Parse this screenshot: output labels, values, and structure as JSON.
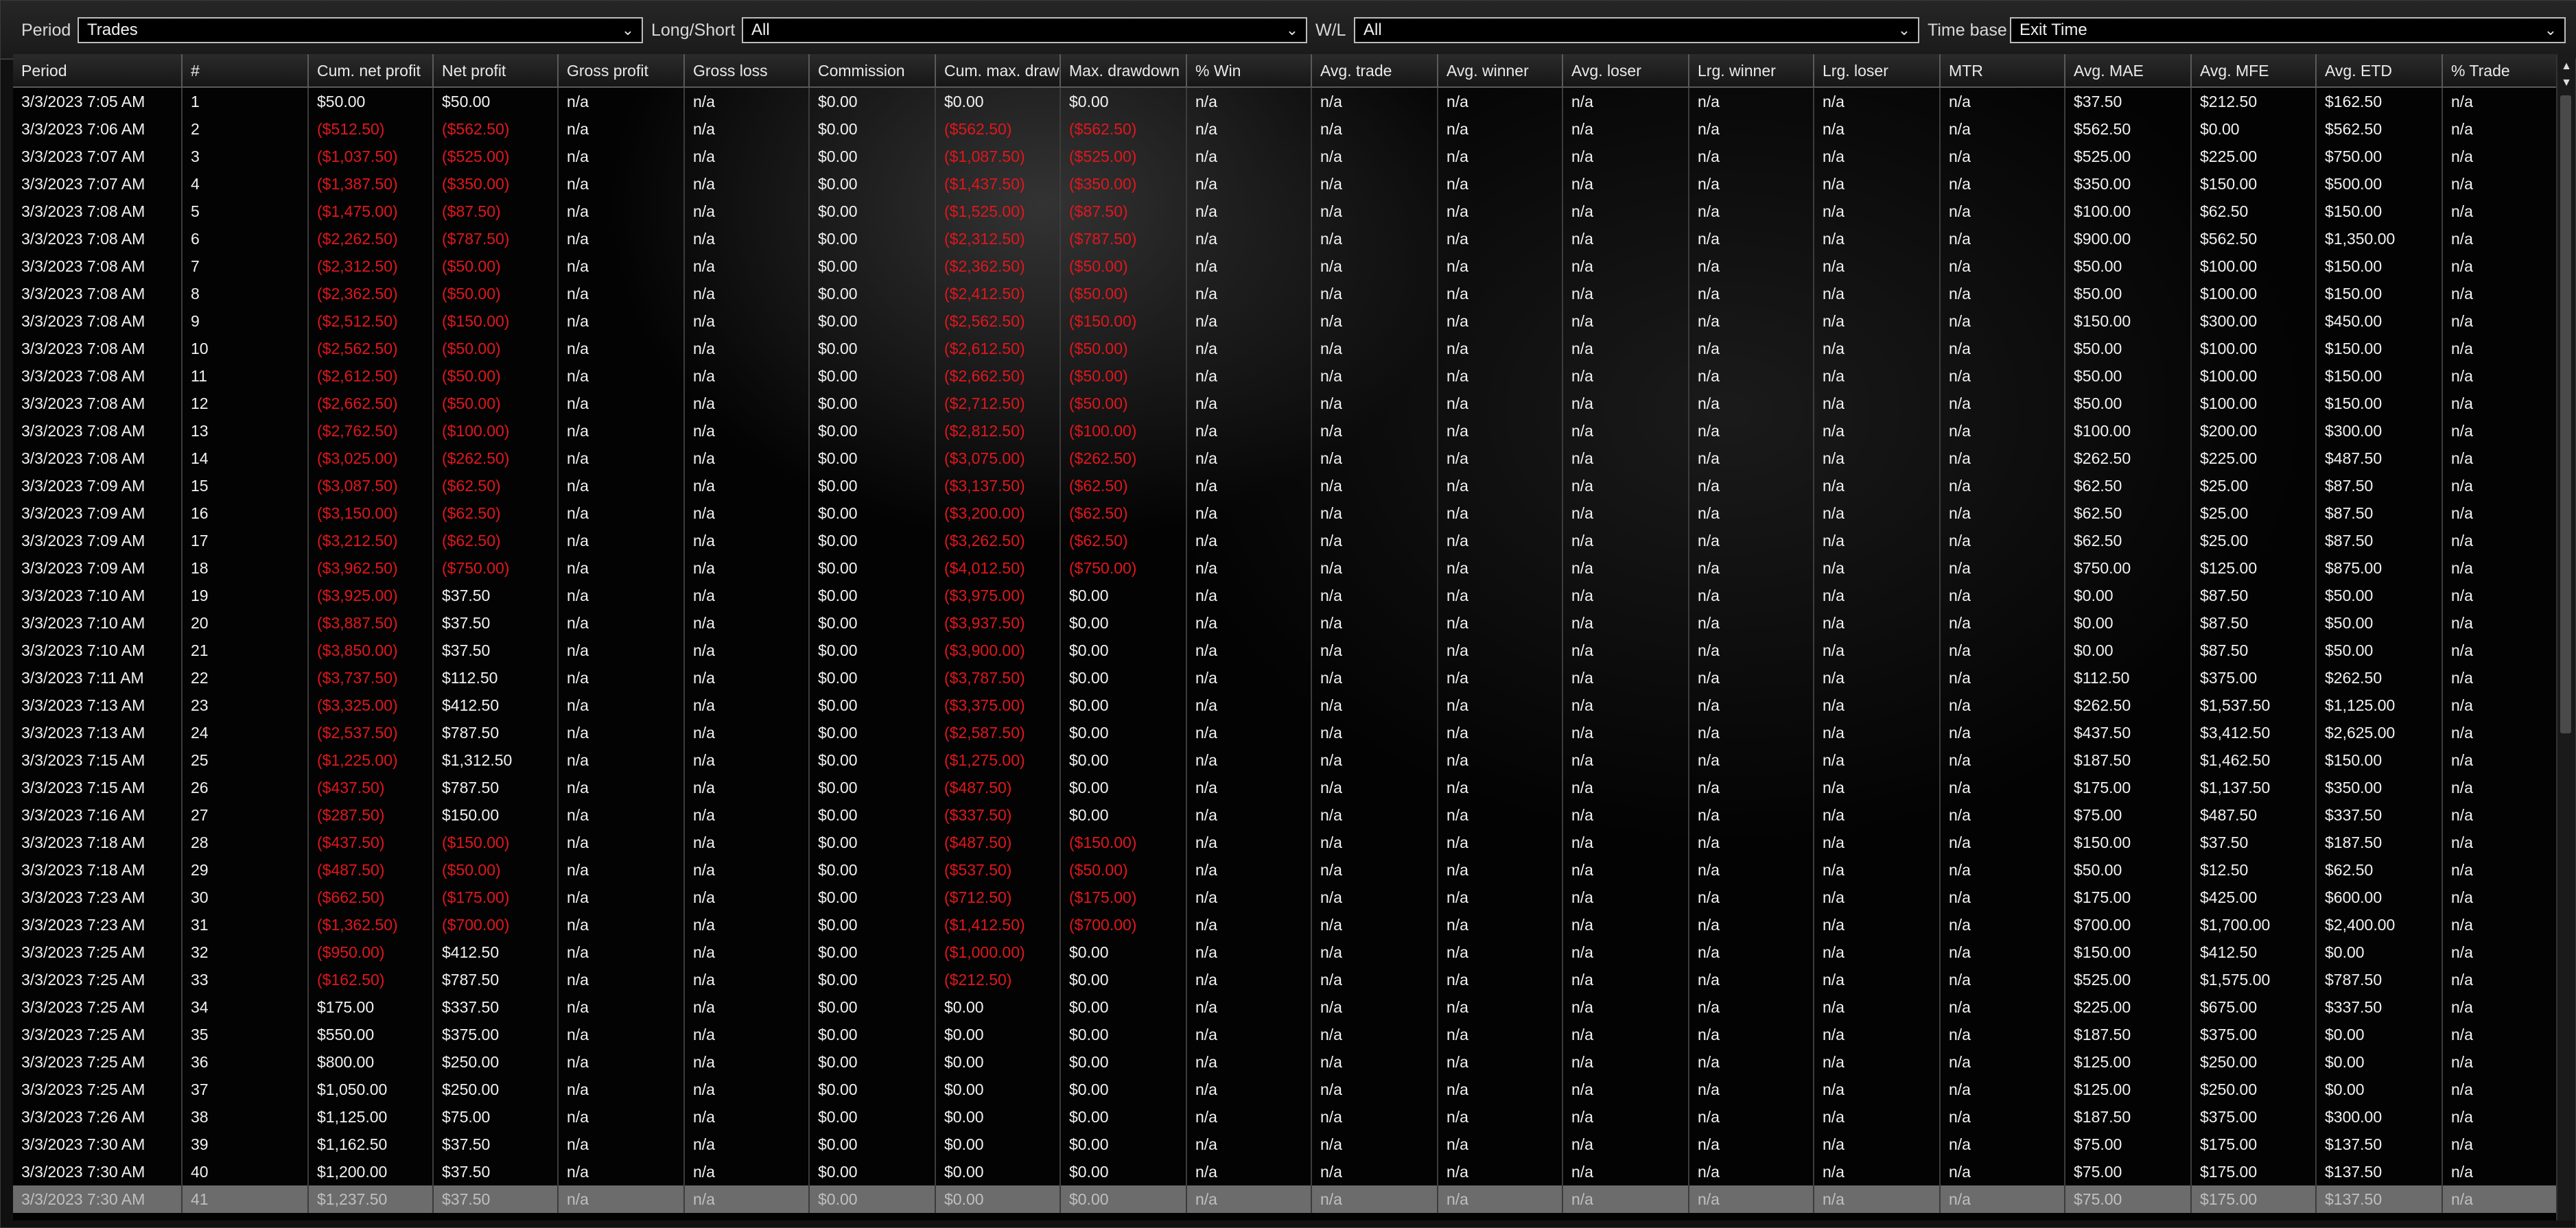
{
  "filters": {
    "period": {
      "label": "Period",
      "value": "Trades"
    },
    "long_short": {
      "label": "Long/Short",
      "value": "All"
    },
    "wl": {
      "label": "W/L",
      "value": "All"
    },
    "time_base": {
      "label": "Time base",
      "value": "Exit Time"
    }
  },
  "table": {
    "columns": [
      "Period",
      "#",
      "Cum. net profit",
      "Net profit",
      "Gross profit",
      "Gross loss",
      "Commission",
      "Cum. max. drawdown",
      "Max. drawdown",
      "% Win",
      "Avg. trade",
      "Avg. winner",
      "Avg. loser",
      "Lrg. winner",
      "Lrg. loser",
      "MTR",
      "Avg. MAE",
      "Avg. MFE",
      "Avg. ETD",
      "% Trade"
    ],
    "rows": [
      [
        "3/3/2023 7:05 AM",
        "1",
        "$50.00",
        "$50.00",
        "n/a",
        "n/a",
        "$0.00",
        "$0.00",
        "$0.00",
        "n/a",
        "n/a",
        "n/a",
        "n/a",
        "n/a",
        "n/a",
        "n/a",
        "$37.50",
        "$212.50",
        "$162.50",
        "n/a"
      ],
      [
        "3/3/2023 7:06 AM",
        "2",
        "($512.50)",
        "($562.50)",
        "n/a",
        "n/a",
        "$0.00",
        "($562.50)",
        "($562.50)",
        "n/a",
        "n/a",
        "n/a",
        "n/a",
        "n/a",
        "n/a",
        "n/a",
        "$562.50",
        "$0.00",
        "$562.50",
        "n/a"
      ],
      [
        "3/3/2023 7:07 AM",
        "3",
        "($1,037.50)",
        "($525.00)",
        "n/a",
        "n/a",
        "$0.00",
        "($1,087.50)",
        "($525.00)",
        "n/a",
        "n/a",
        "n/a",
        "n/a",
        "n/a",
        "n/a",
        "n/a",
        "$525.00",
        "$225.00",
        "$750.00",
        "n/a"
      ],
      [
        "3/3/2023 7:07 AM",
        "4",
        "($1,387.50)",
        "($350.00)",
        "n/a",
        "n/a",
        "$0.00",
        "($1,437.50)",
        "($350.00)",
        "n/a",
        "n/a",
        "n/a",
        "n/a",
        "n/a",
        "n/a",
        "n/a",
        "$350.00",
        "$150.00",
        "$500.00",
        "n/a"
      ],
      [
        "3/3/2023 7:08 AM",
        "5",
        "($1,475.00)",
        "($87.50)",
        "n/a",
        "n/a",
        "$0.00",
        "($1,525.00)",
        "($87.50)",
        "n/a",
        "n/a",
        "n/a",
        "n/a",
        "n/a",
        "n/a",
        "n/a",
        "$100.00",
        "$62.50",
        "$150.00",
        "n/a"
      ],
      [
        "3/3/2023 7:08 AM",
        "6",
        "($2,262.50)",
        "($787.50)",
        "n/a",
        "n/a",
        "$0.00",
        "($2,312.50)",
        "($787.50)",
        "n/a",
        "n/a",
        "n/a",
        "n/a",
        "n/a",
        "n/a",
        "n/a",
        "$900.00",
        "$562.50",
        "$1,350.00",
        "n/a"
      ],
      [
        "3/3/2023 7:08 AM",
        "7",
        "($2,312.50)",
        "($50.00)",
        "n/a",
        "n/a",
        "$0.00",
        "($2,362.50)",
        "($50.00)",
        "n/a",
        "n/a",
        "n/a",
        "n/a",
        "n/a",
        "n/a",
        "n/a",
        "$50.00",
        "$100.00",
        "$150.00",
        "n/a"
      ],
      [
        "3/3/2023 7:08 AM",
        "8",
        "($2,362.50)",
        "($50.00)",
        "n/a",
        "n/a",
        "$0.00",
        "($2,412.50)",
        "($50.00)",
        "n/a",
        "n/a",
        "n/a",
        "n/a",
        "n/a",
        "n/a",
        "n/a",
        "$50.00",
        "$100.00",
        "$150.00",
        "n/a"
      ],
      [
        "3/3/2023 7:08 AM",
        "9",
        "($2,512.50)",
        "($150.00)",
        "n/a",
        "n/a",
        "$0.00",
        "($2,562.50)",
        "($150.00)",
        "n/a",
        "n/a",
        "n/a",
        "n/a",
        "n/a",
        "n/a",
        "n/a",
        "$150.00",
        "$300.00",
        "$450.00",
        "n/a"
      ],
      [
        "3/3/2023 7:08 AM",
        "10",
        "($2,562.50)",
        "($50.00)",
        "n/a",
        "n/a",
        "$0.00",
        "($2,612.50)",
        "($50.00)",
        "n/a",
        "n/a",
        "n/a",
        "n/a",
        "n/a",
        "n/a",
        "n/a",
        "$50.00",
        "$100.00",
        "$150.00",
        "n/a"
      ],
      [
        "3/3/2023 7:08 AM",
        "11",
        "($2,612.50)",
        "($50.00)",
        "n/a",
        "n/a",
        "$0.00",
        "($2,662.50)",
        "($50.00)",
        "n/a",
        "n/a",
        "n/a",
        "n/a",
        "n/a",
        "n/a",
        "n/a",
        "$50.00",
        "$100.00",
        "$150.00",
        "n/a"
      ],
      [
        "3/3/2023 7:08 AM",
        "12",
        "($2,662.50)",
        "($50.00)",
        "n/a",
        "n/a",
        "$0.00",
        "($2,712.50)",
        "($50.00)",
        "n/a",
        "n/a",
        "n/a",
        "n/a",
        "n/a",
        "n/a",
        "n/a",
        "$50.00",
        "$100.00",
        "$150.00",
        "n/a"
      ],
      [
        "3/3/2023 7:08 AM",
        "13",
        "($2,762.50)",
        "($100.00)",
        "n/a",
        "n/a",
        "$0.00",
        "($2,812.50)",
        "($100.00)",
        "n/a",
        "n/a",
        "n/a",
        "n/a",
        "n/a",
        "n/a",
        "n/a",
        "$100.00",
        "$200.00",
        "$300.00",
        "n/a"
      ],
      [
        "3/3/2023 7:08 AM",
        "14",
        "($3,025.00)",
        "($262.50)",
        "n/a",
        "n/a",
        "$0.00",
        "($3,075.00)",
        "($262.50)",
        "n/a",
        "n/a",
        "n/a",
        "n/a",
        "n/a",
        "n/a",
        "n/a",
        "$262.50",
        "$225.00",
        "$487.50",
        "n/a"
      ],
      [
        "3/3/2023 7:09 AM",
        "15",
        "($3,087.50)",
        "($62.50)",
        "n/a",
        "n/a",
        "$0.00",
        "($3,137.50)",
        "($62.50)",
        "n/a",
        "n/a",
        "n/a",
        "n/a",
        "n/a",
        "n/a",
        "n/a",
        "$62.50",
        "$25.00",
        "$87.50",
        "n/a"
      ],
      [
        "3/3/2023 7:09 AM",
        "16",
        "($3,150.00)",
        "($62.50)",
        "n/a",
        "n/a",
        "$0.00",
        "($3,200.00)",
        "($62.50)",
        "n/a",
        "n/a",
        "n/a",
        "n/a",
        "n/a",
        "n/a",
        "n/a",
        "$62.50",
        "$25.00",
        "$87.50",
        "n/a"
      ],
      [
        "3/3/2023 7:09 AM",
        "17",
        "($3,212.50)",
        "($62.50)",
        "n/a",
        "n/a",
        "$0.00",
        "($3,262.50)",
        "($62.50)",
        "n/a",
        "n/a",
        "n/a",
        "n/a",
        "n/a",
        "n/a",
        "n/a",
        "$62.50",
        "$25.00",
        "$87.50",
        "n/a"
      ],
      [
        "3/3/2023 7:09 AM",
        "18",
        "($3,962.50)",
        "($750.00)",
        "n/a",
        "n/a",
        "$0.00",
        "($4,012.50)",
        "($750.00)",
        "n/a",
        "n/a",
        "n/a",
        "n/a",
        "n/a",
        "n/a",
        "n/a",
        "$750.00",
        "$125.00",
        "$875.00",
        "n/a"
      ],
      [
        "3/3/2023 7:10 AM",
        "19",
        "($3,925.00)",
        "$37.50",
        "n/a",
        "n/a",
        "$0.00",
        "($3,975.00)",
        "$0.00",
        "n/a",
        "n/a",
        "n/a",
        "n/a",
        "n/a",
        "n/a",
        "n/a",
        "$0.00",
        "$87.50",
        "$50.00",
        "n/a"
      ],
      [
        "3/3/2023 7:10 AM",
        "20",
        "($3,887.50)",
        "$37.50",
        "n/a",
        "n/a",
        "$0.00",
        "($3,937.50)",
        "$0.00",
        "n/a",
        "n/a",
        "n/a",
        "n/a",
        "n/a",
        "n/a",
        "n/a",
        "$0.00",
        "$87.50",
        "$50.00",
        "n/a"
      ],
      [
        "3/3/2023 7:10 AM",
        "21",
        "($3,850.00)",
        "$37.50",
        "n/a",
        "n/a",
        "$0.00",
        "($3,900.00)",
        "$0.00",
        "n/a",
        "n/a",
        "n/a",
        "n/a",
        "n/a",
        "n/a",
        "n/a",
        "$0.00",
        "$87.50",
        "$50.00",
        "n/a"
      ],
      [
        "3/3/2023 7:11 AM",
        "22",
        "($3,737.50)",
        "$112.50",
        "n/a",
        "n/a",
        "$0.00",
        "($3,787.50)",
        "$0.00",
        "n/a",
        "n/a",
        "n/a",
        "n/a",
        "n/a",
        "n/a",
        "n/a",
        "$112.50",
        "$375.00",
        "$262.50",
        "n/a"
      ],
      [
        "3/3/2023 7:13 AM",
        "23",
        "($3,325.00)",
        "$412.50",
        "n/a",
        "n/a",
        "$0.00",
        "($3,375.00)",
        "$0.00",
        "n/a",
        "n/a",
        "n/a",
        "n/a",
        "n/a",
        "n/a",
        "n/a",
        "$262.50",
        "$1,537.50",
        "$1,125.00",
        "n/a"
      ],
      [
        "3/3/2023 7:13 AM",
        "24",
        "($2,537.50)",
        "$787.50",
        "n/a",
        "n/a",
        "$0.00",
        "($2,587.50)",
        "$0.00",
        "n/a",
        "n/a",
        "n/a",
        "n/a",
        "n/a",
        "n/a",
        "n/a",
        "$437.50",
        "$3,412.50",
        "$2,625.00",
        "n/a"
      ],
      [
        "3/3/2023 7:15 AM",
        "25",
        "($1,225.00)",
        "$1,312.50",
        "n/a",
        "n/a",
        "$0.00",
        "($1,275.00)",
        "$0.00",
        "n/a",
        "n/a",
        "n/a",
        "n/a",
        "n/a",
        "n/a",
        "n/a",
        "$187.50",
        "$1,462.50",
        "$150.00",
        "n/a"
      ],
      [
        "3/3/2023 7:15 AM",
        "26",
        "($437.50)",
        "$787.50",
        "n/a",
        "n/a",
        "$0.00",
        "($487.50)",
        "$0.00",
        "n/a",
        "n/a",
        "n/a",
        "n/a",
        "n/a",
        "n/a",
        "n/a",
        "$175.00",
        "$1,137.50",
        "$350.00",
        "n/a"
      ],
      [
        "3/3/2023 7:16 AM",
        "27",
        "($287.50)",
        "$150.00",
        "n/a",
        "n/a",
        "$0.00",
        "($337.50)",
        "$0.00",
        "n/a",
        "n/a",
        "n/a",
        "n/a",
        "n/a",
        "n/a",
        "n/a",
        "$75.00",
        "$487.50",
        "$337.50",
        "n/a"
      ],
      [
        "3/3/2023 7:18 AM",
        "28",
        "($437.50)",
        "($150.00)",
        "n/a",
        "n/a",
        "$0.00",
        "($487.50)",
        "($150.00)",
        "n/a",
        "n/a",
        "n/a",
        "n/a",
        "n/a",
        "n/a",
        "n/a",
        "$150.00",
        "$37.50",
        "$187.50",
        "n/a"
      ],
      [
        "3/3/2023 7:18 AM",
        "29",
        "($487.50)",
        "($50.00)",
        "n/a",
        "n/a",
        "$0.00",
        "($537.50)",
        "($50.00)",
        "n/a",
        "n/a",
        "n/a",
        "n/a",
        "n/a",
        "n/a",
        "n/a",
        "$50.00",
        "$12.50",
        "$62.50",
        "n/a"
      ],
      [
        "3/3/2023 7:23 AM",
        "30",
        "($662.50)",
        "($175.00)",
        "n/a",
        "n/a",
        "$0.00",
        "($712.50)",
        "($175.00)",
        "n/a",
        "n/a",
        "n/a",
        "n/a",
        "n/a",
        "n/a",
        "n/a",
        "$175.00",
        "$425.00",
        "$600.00",
        "n/a"
      ],
      [
        "3/3/2023 7:23 AM",
        "31",
        "($1,362.50)",
        "($700.00)",
        "n/a",
        "n/a",
        "$0.00",
        "($1,412.50)",
        "($700.00)",
        "n/a",
        "n/a",
        "n/a",
        "n/a",
        "n/a",
        "n/a",
        "n/a",
        "$700.00",
        "$1,700.00",
        "$2,400.00",
        "n/a"
      ],
      [
        "3/3/2023 7:25 AM",
        "32",
        "($950.00)",
        "$412.50",
        "n/a",
        "n/a",
        "$0.00",
        "($1,000.00)",
        "$0.00",
        "n/a",
        "n/a",
        "n/a",
        "n/a",
        "n/a",
        "n/a",
        "n/a",
        "$150.00",
        "$412.50",
        "$0.00",
        "n/a"
      ],
      [
        "3/3/2023 7:25 AM",
        "33",
        "($162.50)",
        "$787.50",
        "n/a",
        "n/a",
        "$0.00",
        "($212.50)",
        "$0.00",
        "n/a",
        "n/a",
        "n/a",
        "n/a",
        "n/a",
        "n/a",
        "n/a",
        "$525.00",
        "$1,575.00",
        "$787.50",
        "n/a"
      ],
      [
        "3/3/2023 7:25 AM",
        "34",
        "$175.00",
        "$337.50",
        "n/a",
        "n/a",
        "$0.00",
        "$0.00",
        "$0.00",
        "n/a",
        "n/a",
        "n/a",
        "n/a",
        "n/a",
        "n/a",
        "n/a",
        "$225.00",
        "$675.00",
        "$337.50",
        "n/a"
      ],
      [
        "3/3/2023 7:25 AM",
        "35",
        "$550.00",
        "$375.00",
        "n/a",
        "n/a",
        "$0.00",
        "$0.00",
        "$0.00",
        "n/a",
        "n/a",
        "n/a",
        "n/a",
        "n/a",
        "n/a",
        "n/a",
        "$187.50",
        "$375.00",
        "$0.00",
        "n/a"
      ],
      [
        "3/3/2023 7:25 AM",
        "36",
        "$800.00",
        "$250.00",
        "n/a",
        "n/a",
        "$0.00",
        "$0.00",
        "$0.00",
        "n/a",
        "n/a",
        "n/a",
        "n/a",
        "n/a",
        "n/a",
        "n/a",
        "$125.00",
        "$250.00",
        "$0.00",
        "n/a"
      ],
      [
        "3/3/2023 7:25 AM",
        "37",
        "$1,050.00",
        "$250.00",
        "n/a",
        "n/a",
        "$0.00",
        "$0.00",
        "$0.00",
        "n/a",
        "n/a",
        "n/a",
        "n/a",
        "n/a",
        "n/a",
        "n/a",
        "$125.00",
        "$250.00",
        "$0.00",
        "n/a"
      ],
      [
        "3/3/2023 7:26 AM",
        "38",
        "$1,125.00",
        "$75.00",
        "n/a",
        "n/a",
        "$0.00",
        "$0.00",
        "$0.00",
        "n/a",
        "n/a",
        "n/a",
        "n/a",
        "n/a",
        "n/a",
        "n/a",
        "$187.50",
        "$375.00",
        "$300.00",
        "n/a"
      ],
      [
        "3/3/2023 7:30 AM",
        "39",
        "$1,162.50",
        "$37.50",
        "n/a",
        "n/a",
        "$0.00",
        "$0.00",
        "$0.00",
        "n/a",
        "n/a",
        "n/a",
        "n/a",
        "n/a",
        "n/a",
        "n/a",
        "$75.00",
        "$175.00",
        "$137.50",
        "n/a"
      ],
      [
        "3/3/2023 7:30 AM",
        "40",
        "$1,200.00",
        "$37.50",
        "n/a",
        "n/a",
        "$0.00",
        "$0.00",
        "$0.00",
        "n/a",
        "n/a",
        "n/a",
        "n/a",
        "n/a",
        "n/a",
        "n/a",
        "$75.00",
        "$175.00",
        "$137.50",
        "n/a"
      ],
      [
        "3/3/2023 7:30 AM",
        "41",
        "$1,237.50",
        "$37.50",
        "n/a",
        "n/a",
        "$0.00",
        "$0.00",
        "$0.00",
        "n/a",
        "n/a",
        "n/a",
        "n/a",
        "n/a",
        "n/a",
        "n/a",
        "$75.00",
        "$175.00",
        "$137.50",
        "n/a"
      ]
    ],
    "selected_row": 41
  },
  "colors": {
    "negative": "#e0171d",
    "selected_row_bg": "#6c6c6c",
    "background": "#030303"
  },
  "icons": {
    "dropdown": "chevron-down-icon",
    "scroll_up": "arrow-up-icon",
    "scroll_down": "arrow-down-icon"
  }
}
